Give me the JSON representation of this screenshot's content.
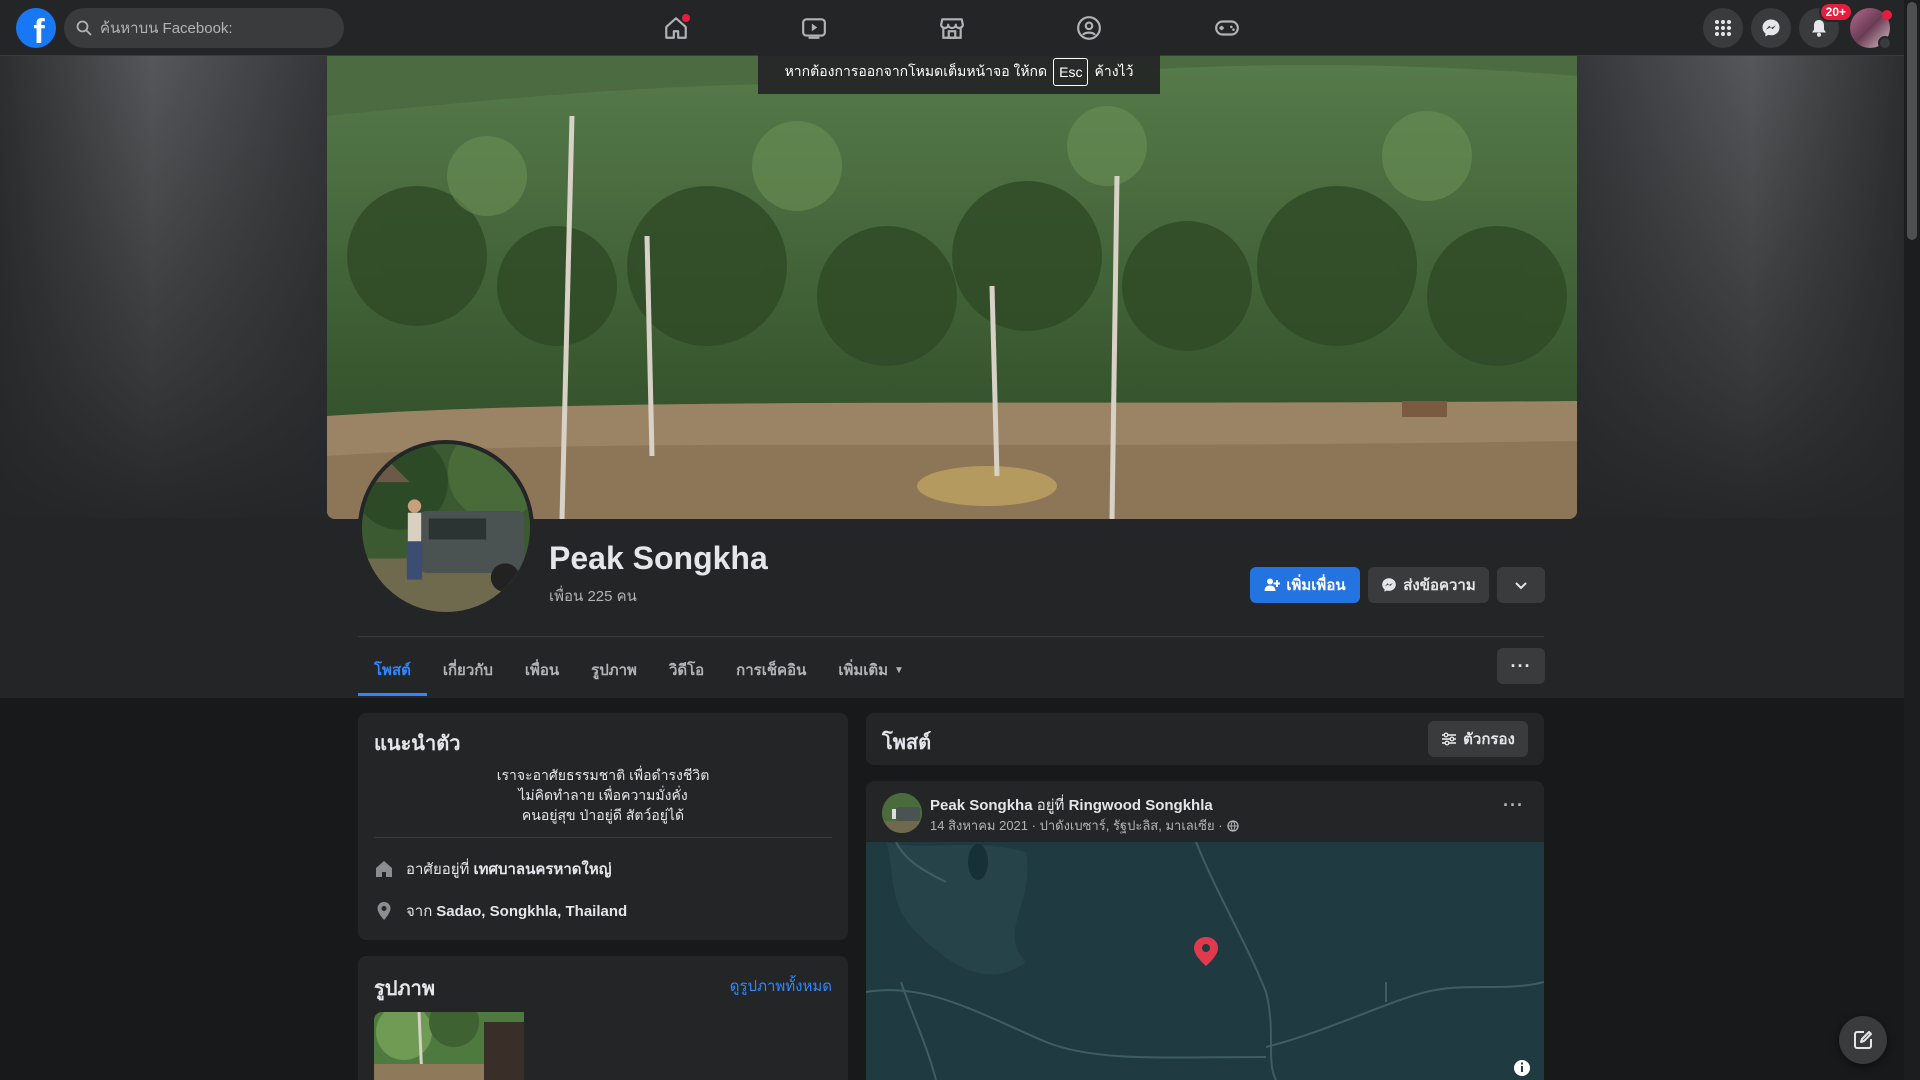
{
  "topnav": {
    "logo_letter": "f",
    "search_placeholder": "ค้นหาบน Facebook:",
    "notification_badge": "20+"
  },
  "fullscreen_toast": {
    "prefix": "หากต้องการออกจากโหมดเต็มหน้าจอ ให้กด",
    "key": "Esc",
    "suffix": "ค้างไว้"
  },
  "profile": {
    "name": "Peak Songkha",
    "friends": "เพื่อน 225 คน",
    "add_friend_label": "เพิ่มเพื่อน",
    "message_label": "ส่งข้อความ"
  },
  "tabs": [
    {
      "label": "โพสต์",
      "active": true
    },
    {
      "label": "เกี่ยวกับ"
    },
    {
      "label": "เพื่อน"
    },
    {
      "label": "รูปภาพ"
    },
    {
      "label": "วิดีโอ"
    },
    {
      "label": "การเช็คอิน"
    },
    {
      "label": "เพิ่มเติม"
    }
  ],
  "intro": {
    "title": "แนะนำตัว",
    "bio": [
      "เราจะอาศัยธรรมชาติ เพื่อดำรงชีวิต",
      "ไม่คิดทำลาย เพื่อความมั่งคั่ง",
      "คนอยู่สุข ป่าอยู่ดี สัตว์อยู่ได้"
    ],
    "lives_prefix": "อาศัยอยู่ที่",
    "lives_value": "เทศบาลนครหาดใหญ่",
    "from_prefix": "จาก",
    "from_value": "Sadao, Songkhla, Thailand"
  },
  "photos": {
    "title": "รูปภาพ",
    "see_all": "ดูรูปภาพทั้งหมด"
  },
  "posts": {
    "title": "โพสต์",
    "filter_label": "ตัวกรอง",
    "post": {
      "author": "Peak Songkha",
      "at_text": "อยู่ที่",
      "place": "Ringwood Songkhla",
      "meta": "14 สิงหาคม 2021 · ปาดังเบซาร์, รัฐปะลิส, มาเลเซีย ·"
    }
  },
  "colors": {
    "accent": "#2374e1",
    "link": "#2d88ff",
    "badge": "#e41e3f",
    "surface": "#242526",
    "background": "#18191a"
  }
}
